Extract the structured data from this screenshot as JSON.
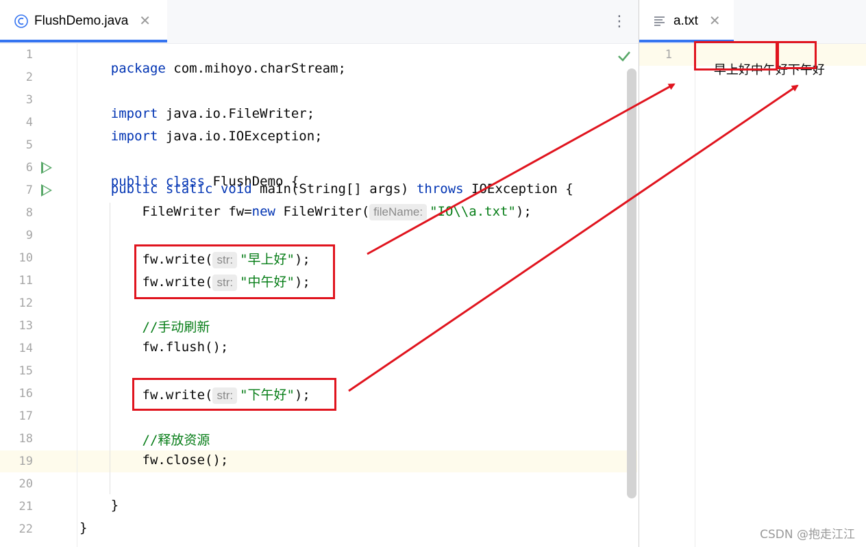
{
  "editor_left": {
    "tab": {
      "icon": "class-icon",
      "title": "FlushDemo.java"
    },
    "lines": [
      {
        "n": "1"
      },
      {
        "n": "2"
      },
      {
        "n": "3"
      },
      {
        "n": "4"
      },
      {
        "n": "5"
      },
      {
        "n": "6"
      },
      {
        "n": "7"
      },
      {
        "n": "8"
      },
      {
        "n": "9"
      },
      {
        "n": "10"
      },
      {
        "n": "11"
      },
      {
        "n": "12"
      },
      {
        "n": "13"
      },
      {
        "n": "14"
      },
      {
        "n": "15"
      },
      {
        "n": "16"
      },
      {
        "n": "17"
      },
      {
        "n": "18"
      },
      {
        "n": "19"
      },
      {
        "n": "20"
      },
      {
        "n": "21"
      },
      {
        "n": "22"
      }
    ],
    "code": {
      "l1_kw": "package",
      "l1_rest": " com.mihoyo.charStream;",
      "l3_kw": "import",
      "l3_rest": " java.io.FileWriter;",
      "l4_kw": "import",
      "l4_rest": " java.io.IOException;",
      "l6_kw1": "public",
      "l6_kw2": "class",
      "l6_rest": " FlushDemo {",
      "l7_kw1": "public",
      "l7_kw2": "static",
      "l7_kw3": "void",
      "l7_mid": " main(String[] args) ",
      "l7_kw4": "throws",
      "l7_rest": " IOException {",
      "l8_a": "FileWriter fw=",
      "l8_kw": "new",
      "l8_b": " FileWriter(",
      "l8_hint": "fileName:",
      "l8_str": "\"IO\\\\a.txt\"",
      "l8_c": ");",
      "l10_a": "fw.write(",
      "l10_hint": "str:",
      "l10_str": "\"早上好\"",
      "l10_c": ");",
      "l11_a": "fw.write(",
      "l11_hint": "str:",
      "l11_str": "\"中午好\"",
      "l11_c": ");",
      "l13_cm": "//手动刷新",
      "l14": "fw.flush();",
      "l16_a": "fw.write(",
      "l16_hint": "str:",
      "l16_str": "\"下午好\"",
      "l16_c": ");",
      "l18_cm": "//释放资源",
      "l19": "fw.close();",
      "l21": "}",
      "l22": "}"
    }
  },
  "editor_right": {
    "tab": {
      "icon": "text-file-icon",
      "title": "a.txt"
    },
    "line_number": "1",
    "content_a": "早上好中午好",
    "content_b": "下午好"
  },
  "watermark": "CSDN @抱走江江",
  "colors": {
    "annotation_red": "#e0141e",
    "current_line": "#fefbec",
    "tab_accent": "#3574f0"
  }
}
